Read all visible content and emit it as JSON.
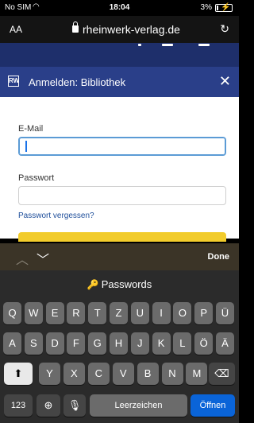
{
  "status_bar": {
    "carrier": "No SIM",
    "time": "18:04",
    "battery_pct": "3%"
  },
  "browser": {
    "aa_label": "AA",
    "url": "rheinwerk-verlag.de"
  },
  "modal": {
    "logo_text": "RW",
    "title": "Anmelden: Bibliothek",
    "email_label": "E-Mail",
    "password_label": "Passwort",
    "forgot_link": "Passwort vergessen?"
  },
  "accessory": {
    "done_label": "Done"
  },
  "keyboard": {
    "suggestion": "Passwords",
    "row1": [
      "Q",
      "W",
      "E",
      "R",
      "T",
      "Z",
      "U",
      "I",
      "O",
      "P",
      "Ü"
    ],
    "row2": [
      "A",
      "S",
      "D",
      "F",
      "G",
      "H",
      "J",
      "K",
      "L",
      "Ö",
      "Ä"
    ],
    "row3": [
      "Y",
      "X",
      "C",
      "V",
      "B",
      "N",
      "M"
    ],
    "numbers_label": "123",
    "space_label": "Leerzeichen",
    "return_label": "Öffnen"
  },
  "colors": {
    "modal_header": "#2a3f89",
    "accent": "#0a64d8",
    "link": "#1d4d9a"
  }
}
